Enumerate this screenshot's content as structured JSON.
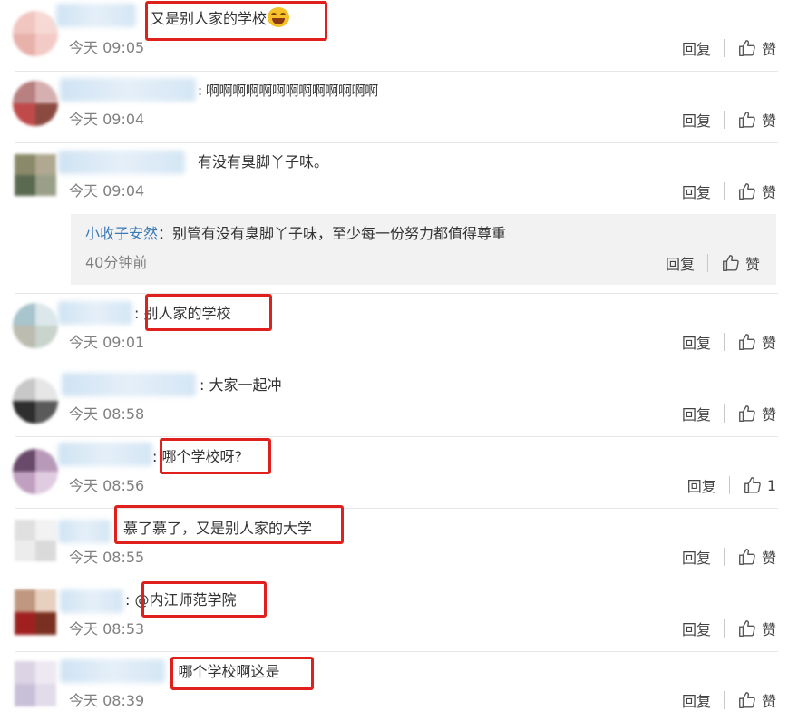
{
  "ui": {
    "reply_label": "回复",
    "like_label": "赞"
  },
  "comments": [
    {
      "separator": "",
      "text": "又是别人家的学校",
      "emoji": "laughing-tears",
      "time": "今天 09:05",
      "likes": "赞"
    },
    {
      "separator": ":",
      "text": "啊啊啊啊啊啊啊啊啊啊啊啊啊",
      "time": "今天 09:04",
      "likes": "赞"
    },
    {
      "separator": "",
      "text": "有没有臭脚丫子味。",
      "time": "今天 09:04",
      "likes": "赞",
      "reply": {
        "user": "小收子安然",
        "text": "：别管有没有臭脚丫子味，至少每一份努力都值得尊重",
        "time": "40分钟前",
        "likes": "赞"
      }
    },
    {
      "separator": ":",
      "text": "别人家的学校",
      "time": "今天 09:01",
      "likes": "赞"
    },
    {
      "separator": ":",
      "text": "大家一起冲",
      "time": "今天 08:58",
      "likes": "赞"
    },
    {
      "separator": ":",
      "text": "哪个学校呀?",
      "time": "今天 08:56",
      "likes": "1"
    },
    {
      "separator": "",
      "text": "慕了慕了，又是别人家的大学",
      "time": "今天 08:55",
      "likes": "赞"
    },
    {
      "separator": ":",
      "text": "@内江师范学院",
      "time": "今天 08:53",
      "likes": "赞"
    },
    {
      "separator": ":",
      "text": "哪个学校啊这是",
      "time": "今天 08:39",
      "likes": "赞"
    }
  ],
  "colors": {
    "highlight": "#e0201c",
    "link": "#3a7ab8",
    "timestamp": "#808080"
  }
}
